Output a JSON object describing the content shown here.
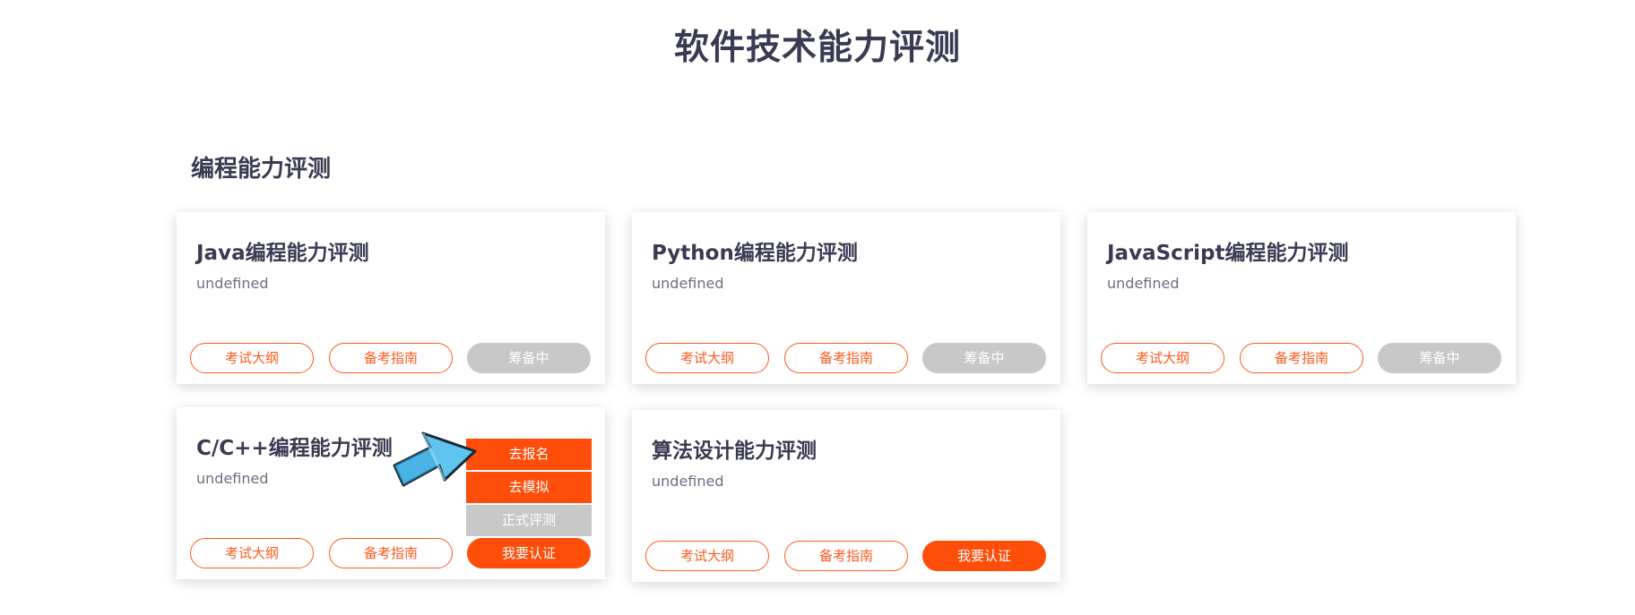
{
  "page": {
    "title": "软件技术能力评测"
  },
  "section": {
    "title": "编程能力评测"
  },
  "cards": [
    {
      "title": "Java编程能力评测",
      "desc": "undefined",
      "btn_outline_1": "考试大纲",
      "btn_outline_2": "备考指南",
      "btn_status": "筹备中"
    },
    {
      "title": "Python编程能力评测",
      "desc": "undefined",
      "btn_outline_1": "考试大纲",
      "btn_outline_2": "备考指南",
      "btn_status": "筹备中"
    },
    {
      "title": "JavaScript编程能力评测",
      "desc": "undefined",
      "btn_outline_1": "考试大纲",
      "btn_outline_2": "备考指南",
      "btn_status": "筹备中"
    },
    {
      "title": "C/C++编程能力评测",
      "desc": "undefined",
      "btn_outline_1": "考试大纲",
      "btn_outline_2": "备考指南",
      "btn_status": "我要认证"
    },
    {
      "title": "算法设计能力评测",
      "desc": "undefined",
      "btn_outline_1": "考试大纲",
      "btn_outline_2": "备考指南",
      "btn_status": "我要认证"
    }
  ],
  "dropdown": {
    "items": [
      "去报名",
      "去模拟",
      "正式评测"
    ]
  },
  "colors": {
    "accent": "#ff4d0a",
    "outline": "#ff5a1f",
    "disabled": "#c8c8c8",
    "heading": "#3a3a52",
    "muted": "#6e6e80"
  },
  "icons": {
    "cursor": "pointer-arrow-icon"
  }
}
